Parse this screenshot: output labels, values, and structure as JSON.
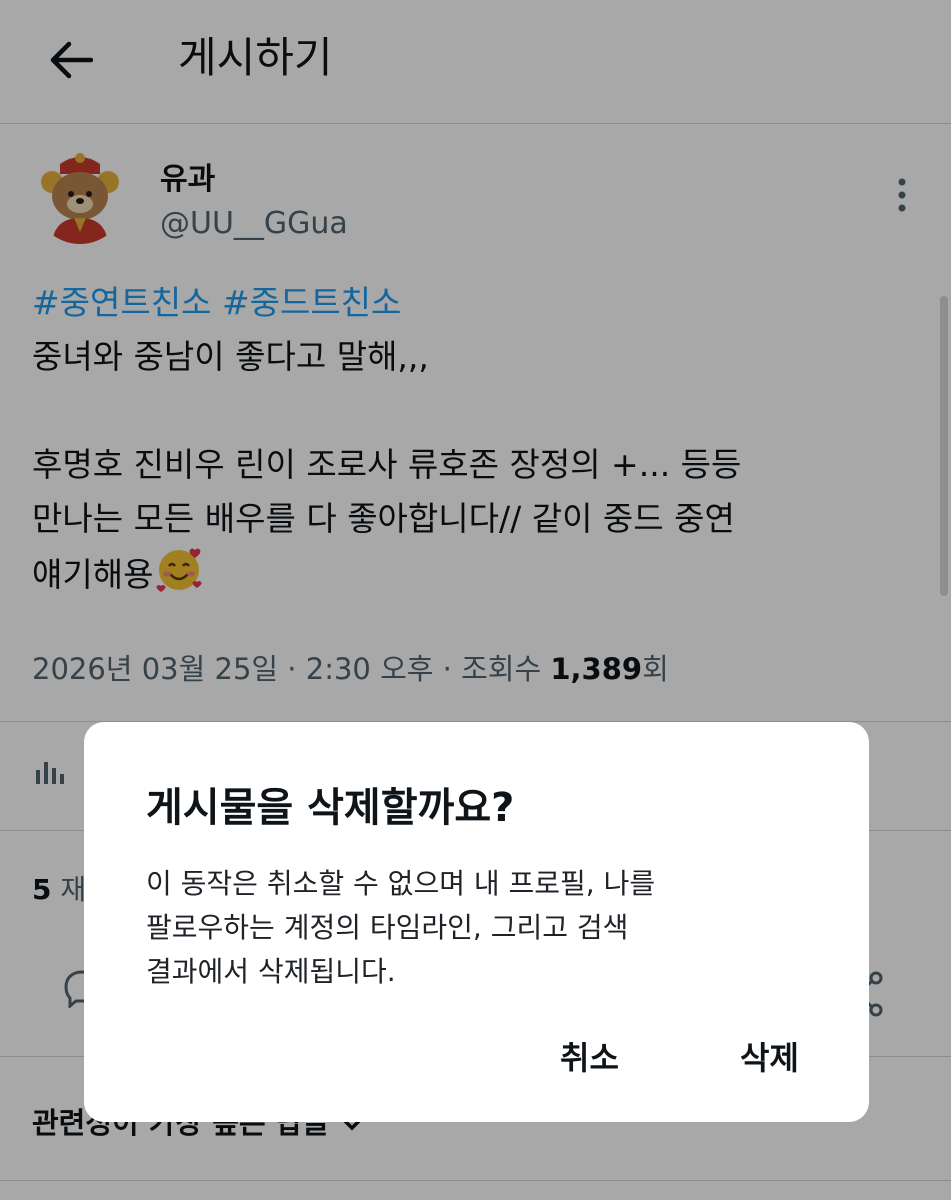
{
  "header": {
    "title": "게시하기"
  },
  "post": {
    "author_name": "유과",
    "author_handle": "@UU__GGua",
    "hashtags": [
      "#중연트친소",
      "#중드트친소"
    ],
    "text_lines": [
      "중녀와 중남이 좋다고 말해,,,",
      "",
      "후명호 진비우 린이 조로사 류호존 장정의 +... 등등",
      "만나는 모든 배우를 다 좋아합니다//  같이 중드 중연",
      "얘기해용"
    ],
    "emoji_icon": "smiling-face-with-hearts",
    "timestamp": "2026년 03월 25일 · 2:30 오후 · 조회수 ",
    "views": "1,389",
    "views_suffix": "회",
    "analytics_label": "​",
    "reposts_count": "5",
    "reposts_label": "재",
    "sort_label": "관련성이 가장 높은 답글"
  },
  "dialog": {
    "title": "게시물을 삭제할까요?",
    "body_lines": [
      "이 동작은 취소할 수 없으며 내 프로필, 나를",
      "팔로우하는 계정의 타임라인, 그리고 검색",
      "결과에서 삭제됩니다."
    ],
    "cancel_label": "취소",
    "delete_label": "삭제"
  },
  "colors": {
    "accent": "#1d9bf0",
    "text": "#0f1419",
    "muted": "#536471",
    "overlay": "rgba(0,0,0,0.34)"
  }
}
